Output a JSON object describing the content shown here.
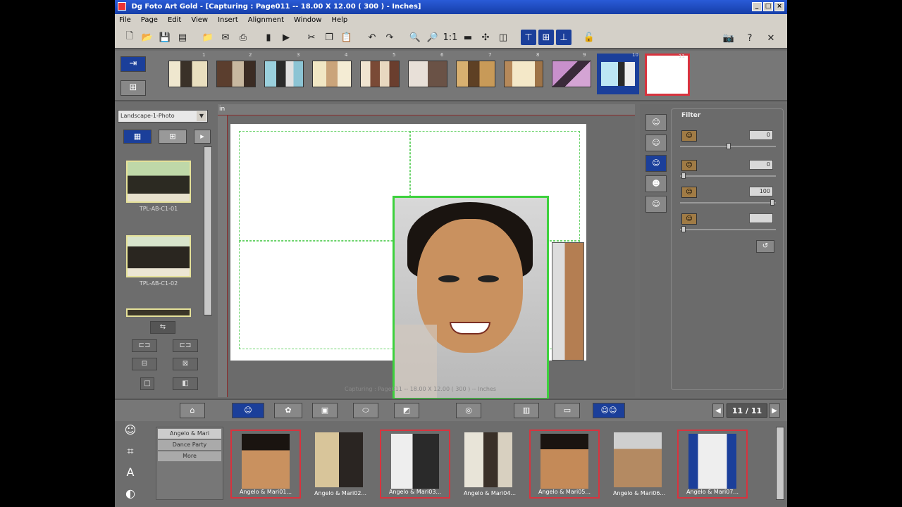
{
  "window": {
    "title": "Dg Foto Art Gold - [Capturing : Page011 -- 18.00 X 12.00 ( 300 ) - Inches]",
    "controls": [
      "_",
      "□",
      "×"
    ]
  },
  "menu": [
    "File",
    "Page",
    "Edit",
    "View",
    "Insert",
    "Alignment",
    "Window",
    "Help"
  ],
  "toolbar": {
    "zoom_ratio_label": "1:1"
  },
  "page_strip": {
    "page_numbers": [
      "1",
      "2",
      "3",
      "4",
      "5",
      "6",
      "7",
      "8",
      "9",
      "10",
      "11"
    ],
    "selected_page": 11
  },
  "left_panel": {
    "layout_select": "Landscape-1-Photo",
    "templates": [
      {
        "label": "TPL-AB-C1-01"
      },
      {
        "label": "TPL-AB-C1-02"
      }
    ]
  },
  "canvas": {
    "ruler_unit": "in",
    "status": "Capturing : Page011 -- 18.00 X 12.00 ( 300 ) -- Inches"
  },
  "filter_panel": {
    "title": "Filter",
    "rows": [
      {
        "value": "0"
      },
      {
        "value": "0"
      },
      {
        "value": "100"
      },
      {
        "value": ""
      }
    ]
  },
  "navigator": {
    "page_count": "11 / 11",
    "prev": "◀",
    "next": "▶"
  },
  "albums": {
    "items": [
      "Angelo & Mari",
      "Dance Party",
      "More"
    ]
  },
  "photos": [
    {
      "label": "Angelo & Mari01..."
    },
    {
      "label": "Angelo & Mari02..."
    },
    {
      "label": "Angelo & Mari03..."
    },
    {
      "label": "Angelo & Mari04..."
    },
    {
      "label": "Angelo & Mari05..."
    },
    {
      "label": "Angelo & Mari06..."
    },
    {
      "label": "Angelo & Mari07..."
    }
  ]
}
